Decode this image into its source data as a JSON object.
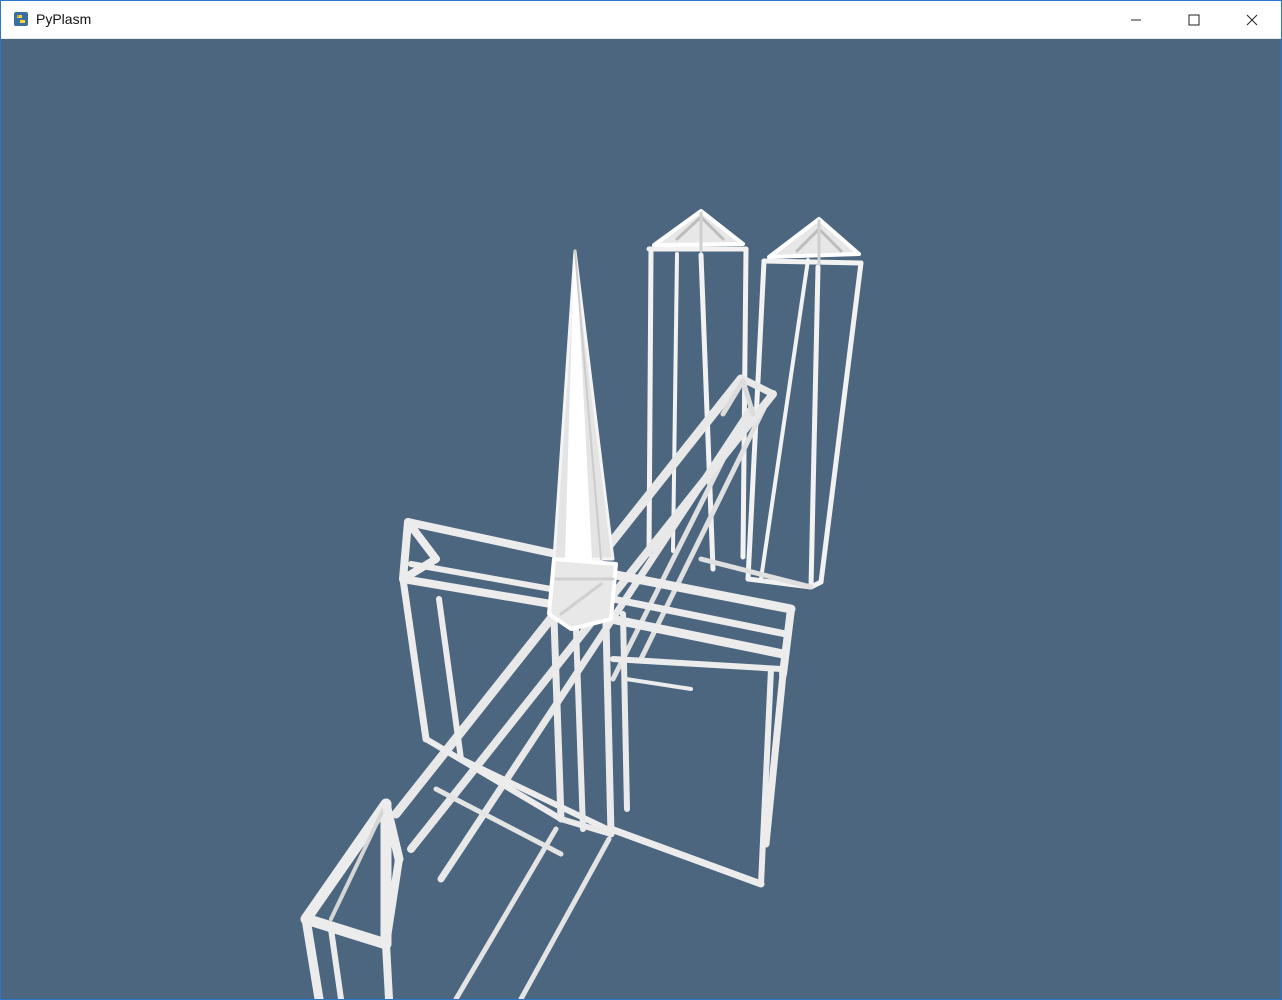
{
  "window": {
    "title": "PyPlasm",
    "icon": "python-icon",
    "controls": [
      "minimize-icon",
      "maximize-icon",
      "close-icon"
    ]
  },
  "viewport": {
    "background_color": "#4d6680",
    "model_color": "#eeeeee",
    "content": "wireframe-3d-model"
  }
}
